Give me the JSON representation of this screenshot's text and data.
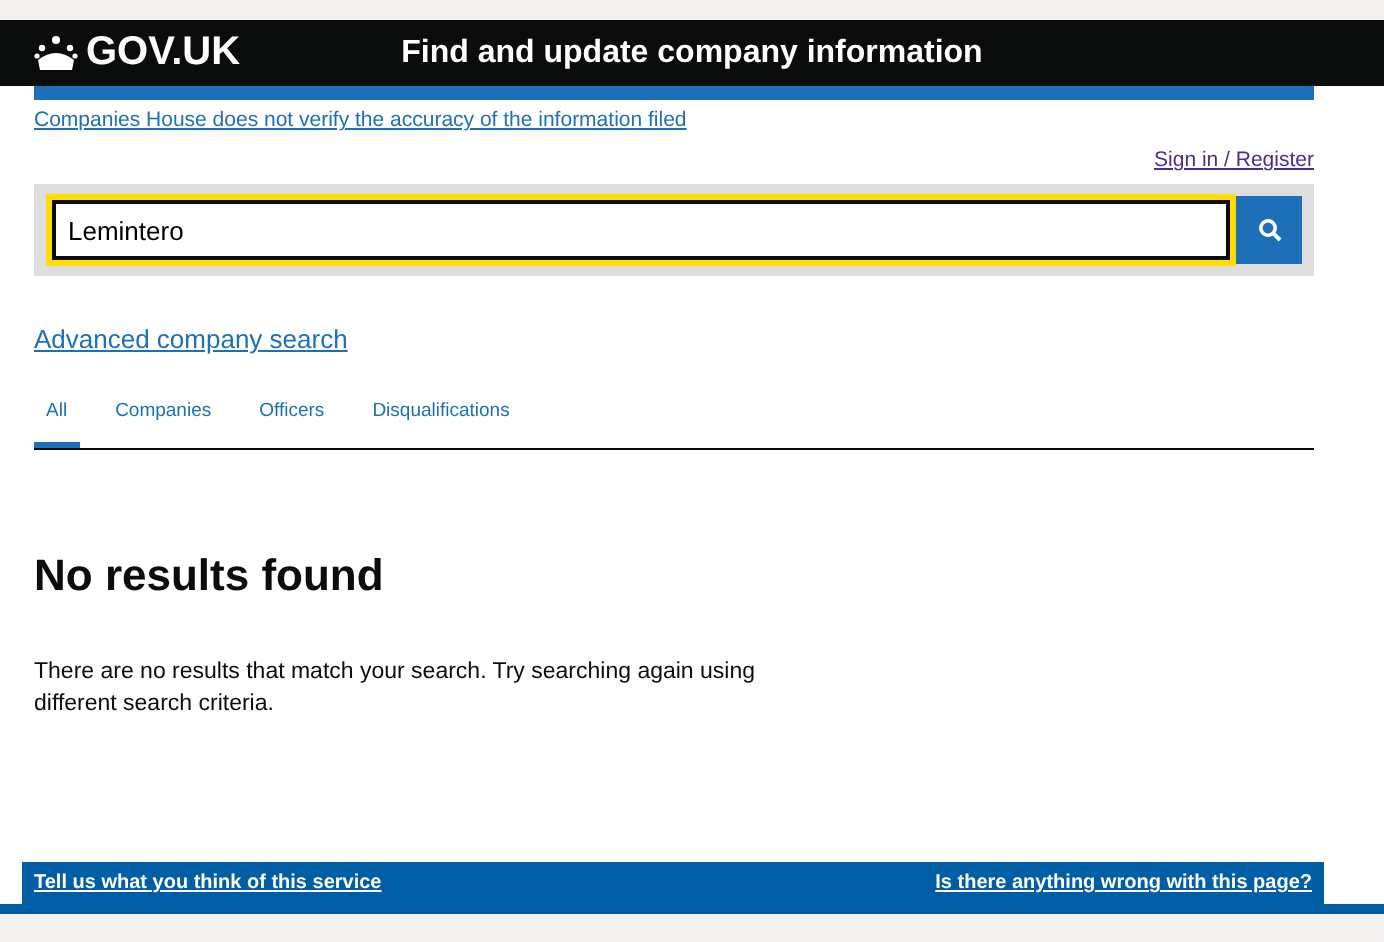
{
  "header": {
    "logo": "GOV.UK",
    "title": "Find and update company information"
  },
  "disclaimer": "Companies House does not verify the accuracy of the information filed",
  "sign_in": "Sign in / Register",
  "search": {
    "value": "Lemintero"
  },
  "advanced_link": "Advanced company search",
  "tabs": [
    {
      "label": "All",
      "selected": true
    },
    {
      "label": "Companies",
      "selected": false
    },
    {
      "label": "Officers",
      "selected": false
    },
    {
      "label": "Disqualifications",
      "selected": false
    }
  ],
  "results": {
    "heading": "No results found",
    "message": "There are no results that match your search. Try searching again using different search criteria."
  },
  "footer": {
    "feedback_link": "Tell us what you think of this service",
    "report_link": "Is there anything wrong with this page?"
  }
}
